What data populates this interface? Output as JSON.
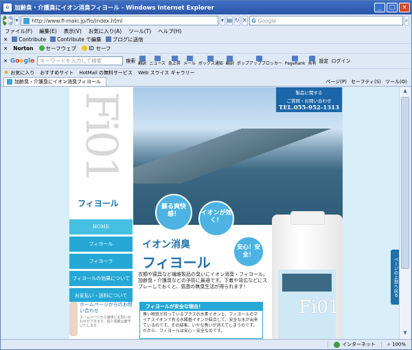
{
  "window": {
    "title": "加齢臭・介護臭にイオン消臭フィヨール - Windows Internet Explorer",
    "minimize": "_",
    "maximize": "□",
    "close": "×"
  },
  "address": {
    "url": "http://www.fi-maki.jp/fio/index.html",
    "search_placeholder": "Google"
  },
  "menu": [
    "ファイル(F)",
    "編集(E)",
    "表示(V)",
    "お気に入り(A)",
    "ツール(T)",
    "ヘルプ(H)"
  ],
  "contrib": {
    "contribute": "Contribute",
    "edit": "Contribute で編集",
    "blog": "ブログに送信"
  },
  "norton": {
    "brand": "Norton",
    "safeweb": "セーフウェブ",
    "idsafe": "ID セーフ"
  },
  "googlebar": {
    "input_placeholder": "キーワードを入力して検索",
    "search_label": "検索",
    "tools": [
      "翻訳",
      "ニュース",
      "急上昇",
      "メール",
      "ボックス通知",
      "翻訳",
      "ポップアップブロッカー",
      "PageRank",
      "共有"
    ],
    "settings": "設定",
    "login": "ログイン"
  },
  "favbar": {
    "favorites": "お気に入り",
    "suggested": "おすすめサイト",
    "hotmail": "HotMail の無料サービス",
    "webslice": "Web スライス ギャラリー"
  },
  "tab": {
    "title": "加齢臭・介護臭にイオン消臭フィヨール",
    "commands": [
      "ページ(P)",
      "セーフティ(S)",
      "ツール(O)"
    ]
  },
  "site": {
    "logo": "Fi01",
    "brand": "フィヨール",
    "nav": [
      "HOME",
      "フィヨール",
      "フィヨーラ",
      "フィヨールの効果について",
      "お支払い・送料について"
    ],
    "contact_title": "ホームページからのお問い合わせ",
    "contact_note": "ホームページから簡単にお問い合わせができます。個人情報は厳守いたします。",
    "phone_line1": "製品に関する",
    "phone_line2": "ご質問・お問い合わせ",
    "phone_number": "TEL.055-952-1313",
    "bubble1": "蘇る爽快感！",
    "bubble2": "イオンが効く！",
    "bubble3": "安心！安全！",
    "headline_a": "イオン消臭",
    "headline_b": "フィヨール",
    "description": "衣類や寝具など繊維製品の臭いにイオン消臭・フィヨール。加齢臭・介護臭などの予防に最適です。下着や背広などにスプレーしておくと、感激の無臭生活が得られます！",
    "safe_heading": "フィヨールが安全な理由！",
    "safe_body": "臭い物質が持っているプラスの水素イオンと、フィヨールのマイナスイオンで有る水酸基イオンが結合して、安全な水が出来ているのです。その結果、いやな臭いが消えてしまうのです。だから、フィヨールは安心・安全なのです。",
    "bottle_label": "Fi01",
    "side_tab": "ページの上部へ戻る"
  },
  "status": {
    "zone": "インターネット",
    "zoom": "100%"
  }
}
